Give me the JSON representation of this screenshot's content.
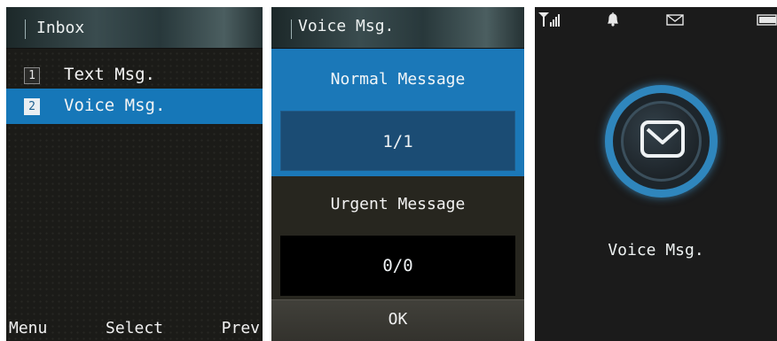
{
  "screen_inbox": {
    "title": "Inbox",
    "items": [
      {
        "number": "1",
        "label": "Text Msg."
      },
      {
        "number": "2",
        "label": "Voice Msg."
      }
    ],
    "selected_index": 1,
    "softkeys": {
      "left": "Menu",
      "center": "Select",
      "right": "Prev"
    }
  },
  "screen_voice": {
    "title": "Voice Msg.",
    "normal_label": "Normal Message",
    "normal_count": "1/1",
    "urgent_label": "Urgent Message",
    "urgent_count": "0/0",
    "ok_label": "OK"
  },
  "screen_notify": {
    "status_icons": [
      "signal-icon",
      "bell-icon",
      "envelope-icon",
      "battery-icon"
    ],
    "label": "Voice Msg."
  },
  "colors": {
    "highlight_blue": "#1677b8",
    "dark_panel": "#1b4c74",
    "ring_blue": "#2f86bd"
  }
}
